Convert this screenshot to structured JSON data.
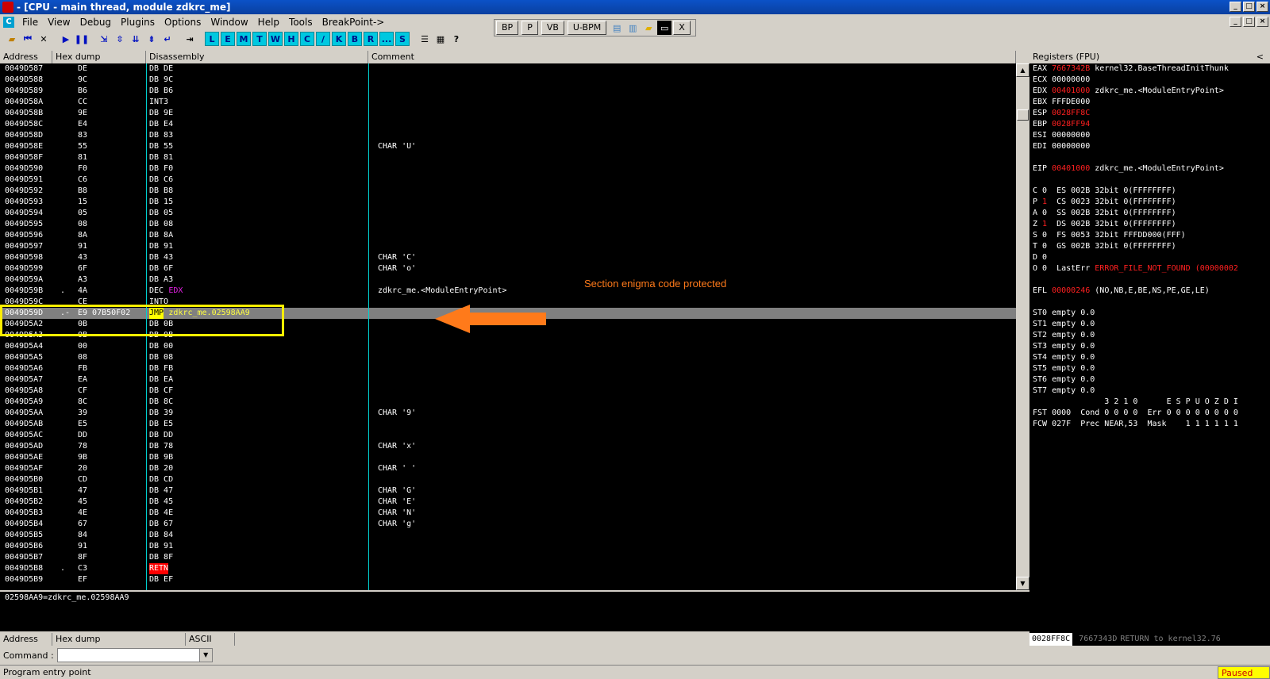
{
  "window": {
    "title": "- [CPU - main thread, module zdkrc_me]"
  },
  "menu": {
    "icon_letter": "C",
    "items": [
      "File",
      "View",
      "Debug",
      "Plugins",
      "Options",
      "Window",
      "Help",
      "Tools",
      "BreakPoint->"
    ]
  },
  "toolbar": {
    "letter_buttons": [
      "L",
      "E",
      "M",
      "T",
      "W",
      "H",
      "C",
      "/",
      "K",
      "B",
      "R",
      "...",
      "S"
    ],
    "help_label": "?"
  },
  "bp_toolbar": {
    "buttons": [
      "BP",
      "P",
      "VB",
      "U-BPM"
    ],
    "close_label": "X"
  },
  "cpu_headers": {
    "address": "Address",
    "hex": "Hex dump",
    "disasm": "Disassembly",
    "comment": "Comment"
  },
  "disasm_rows": [
    {
      "addr": "0049D587",
      "mk": "",
      "hex": "DE",
      "dis": "DB DE",
      "cmt": ""
    },
    {
      "addr": "0049D588",
      "mk": "",
      "hex": "9C",
      "dis": "DB 9C",
      "cmt": ""
    },
    {
      "addr": "0049D589",
      "mk": "",
      "hex": "B6",
      "dis": "DB B6",
      "cmt": ""
    },
    {
      "addr": "0049D58A",
      "mk": "",
      "hex": "CC",
      "dis": "INT3",
      "cmt": ""
    },
    {
      "addr": "0049D58B",
      "mk": "",
      "hex": "9E",
      "dis": "DB 9E",
      "cmt": ""
    },
    {
      "addr": "0049D58C",
      "mk": "",
      "hex": "E4",
      "dis": "DB E4",
      "cmt": ""
    },
    {
      "addr": "0049D58D",
      "mk": "",
      "hex": "83",
      "dis": "DB 83",
      "cmt": ""
    },
    {
      "addr": "0049D58E",
      "mk": "",
      "hex": "55",
      "dis": "DB 55",
      "cmt": "CHAR 'U'"
    },
    {
      "addr": "0049D58F",
      "mk": "",
      "hex": "81",
      "dis": "DB 81",
      "cmt": ""
    },
    {
      "addr": "0049D590",
      "mk": "",
      "hex": "F0",
      "dis": "DB F0",
      "cmt": ""
    },
    {
      "addr": "0049D591",
      "mk": "",
      "hex": "C6",
      "dis": "DB C6",
      "cmt": ""
    },
    {
      "addr": "0049D592",
      "mk": "",
      "hex": "B8",
      "dis": "DB B8",
      "cmt": ""
    },
    {
      "addr": "0049D593",
      "mk": "",
      "hex": "15",
      "dis": "DB 15",
      "cmt": ""
    },
    {
      "addr": "0049D594",
      "mk": "",
      "hex": "05",
      "dis": "DB 05",
      "cmt": ""
    },
    {
      "addr": "0049D595",
      "mk": "",
      "hex": "08",
      "dis": "DB 08",
      "cmt": ""
    },
    {
      "addr": "0049D596",
      "mk": "",
      "hex": "8A",
      "dis": "DB 8A",
      "cmt": ""
    },
    {
      "addr": "0049D597",
      "mk": "",
      "hex": "91",
      "dis": "DB 91",
      "cmt": ""
    },
    {
      "addr": "0049D598",
      "mk": "",
      "hex": "43",
      "dis": "DB 43",
      "cmt": "CHAR 'C'"
    },
    {
      "addr": "0049D599",
      "mk": "",
      "hex": "6F",
      "dis": "DB 6F",
      "cmt": "CHAR 'o'"
    },
    {
      "addr": "0049D59A",
      "mk": "",
      "hex": "A3",
      "dis": "DB A3",
      "cmt": ""
    },
    {
      "addr": "0049D59B",
      "mk": ".",
      "hex": "4A",
      "dis": "DEC",
      "dis2": "EDX",
      "cmt": "zdkrc_me.<ModuleEntryPoint>"
    },
    {
      "addr": "0049D59C",
      "mk": "",
      "hex": "CE",
      "dis": "INTO",
      "cmt": ""
    },
    {
      "addr": "0049D59D",
      "mk": ".-",
      "hex": "E9 07B50F02",
      "dis": "JMP",
      "dis2": "zdkrc_me.02598AA9",
      "cmt": "",
      "sel": true
    },
    {
      "addr": "0049D5A2",
      "mk": "",
      "hex": "0B",
      "dis": "DB 0B",
      "cmt": ""
    },
    {
      "addr": "0049D5A3",
      "mk": "",
      "hex": "0B",
      "dis": "DB 0B",
      "cmt": ""
    },
    {
      "addr": "0049D5A4",
      "mk": "",
      "hex": "00",
      "dis": "DB 00",
      "cmt": ""
    },
    {
      "addr": "0049D5A5",
      "mk": "",
      "hex": "08",
      "dis": "DB 08",
      "cmt": ""
    },
    {
      "addr": "0049D5A6",
      "mk": "",
      "hex": "FB",
      "dis": "DB FB",
      "cmt": ""
    },
    {
      "addr": "0049D5A7",
      "mk": "",
      "hex": "EA",
      "dis": "DB EA",
      "cmt": ""
    },
    {
      "addr": "0049D5A8",
      "mk": "",
      "hex": "CF",
      "dis": "DB CF",
      "cmt": ""
    },
    {
      "addr": "0049D5A9",
      "mk": "",
      "hex": "8C",
      "dis": "DB 8C",
      "cmt": ""
    },
    {
      "addr": "0049D5AA",
      "mk": "",
      "hex": "39",
      "dis": "DB 39",
      "cmt": "CHAR '9'"
    },
    {
      "addr": "0049D5AB",
      "mk": "",
      "hex": "E5",
      "dis": "DB E5",
      "cmt": ""
    },
    {
      "addr": "0049D5AC",
      "mk": "",
      "hex": "DD",
      "dis": "DB DD",
      "cmt": ""
    },
    {
      "addr": "0049D5AD",
      "mk": "",
      "hex": "78",
      "dis": "DB 78",
      "cmt": "CHAR 'x'"
    },
    {
      "addr": "0049D5AE",
      "mk": "",
      "hex": "9B",
      "dis": "DB 9B",
      "cmt": ""
    },
    {
      "addr": "0049D5AF",
      "mk": "",
      "hex": "20",
      "dis": "DB 20",
      "cmt": "CHAR ' '"
    },
    {
      "addr": "0049D5B0",
      "mk": "",
      "hex": "CD",
      "dis": "DB CD",
      "cmt": ""
    },
    {
      "addr": "0049D5B1",
      "mk": "",
      "hex": "47",
      "dis": "DB 47",
      "cmt": "CHAR 'G'"
    },
    {
      "addr": "0049D5B2",
      "mk": "",
      "hex": "45",
      "dis": "DB 45",
      "cmt": "CHAR 'E'"
    },
    {
      "addr": "0049D5B3",
      "mk": "",
      "hex": "4E",
      "dis": "DB 4E",
      "cmt": "CHAR 'N'"
    },
    {
      "addr": "0049D5B4",
      "mk": "",
      "hex": "67",
      "dis": "DB 67",
      "cmt": "CHAR 'g'"
    },
    {
      "addr": "0049D5B5",
      "mk": "",
      "hex": "84",
      "dis": "DB 84",
      "cmt": ""
    },
    {
      "addr": "0049D5B6",
      "mk": "",
      "hex": "91",
      "dis": "DB 91",
      "cmt": ""
    },
    {
      "addr": "0049D5B7",
      "mk": "",
      "hex": "8F",
      "dis": "DB 8F",
      "cmt": ""
    },
    {
      "addr": "0049D5B8",
      "mk": ".",
      "hex": "C3",
      "dis": "RETN",
      "cmt": ""
    },
    {
      "addr": "0049D5B9",
      "mk": "",
      "hex": "EF",
      "dis": "DB EF",
      "cmt": ""
    }
  ],
  "annotation": {
    "text": "Section enigma code protected",
    "color": "#ff7a1a",
    "highlight_color": "#ffee00"
  },
  "registers": {
    "header": "Registers (FPU)",
    "collapse": "<",
    "lines": [
      [
        "EAX ",
        "7667342B",
        " kernel32.BaseThreadInitThunk"
      ],
      [
        "ECX 00000000"
      ],
      [
        "EDX ",
        "00401000",
        " zdkrc_me.<ModuleEntryPoint>"
      ],
      [
        "EBX FFFDE000"
      ],
      [
        "ESP ",
        "0028FF8C",
        ""
      ],
      [
        "EBP ",
        "0028FF94",
        ""
      ],
      [
        "ESI 00000000"
      ],
      [
        "EDI 00000000"
      ],
      [
        ""
      ],
      [
        "EIP ",
        "00401000",
        " zdkrc_me.<ModuleEntryPoint>"
      ],
      [
        ""
      ],
      [
        "C 0  ES 002B 32bit 0(FFFFFFFF)"
      ],
      [
        "P ",
        "1",
        "  CS 0023 32bit 0(FFFFFFFF)"
      ],
      [
        "A 0  SS 002B 32bit 0(FFFFFFFF)"
      ],
      [
        "Z ",
        "1",
        "  DS 002B 32bit 0(FFFFFFFF)"
      ],
      [
        "S 0  FS 0053 32bit FFFDD000(FFF)"
      ],
      [
        "T 0  GS 002B 32bit 0(FFFFFFFF)"
      ],
      [
        "D 0"
      ],
      [
        "O 0  LastErr ",
        "ERROR_FILE_NOT_FOUND (00000002",
        ""
      ],
      [
        ""
      ],
      [
        "EFL ",
        "00000246",
        " (NO,NB,E,BE,NS,PE,GE,LE)"
      ],
      [
        ""
      ],
      [
        "ST0 empty 0.0"
      ],
      [
        "ST1 empty 0.0"
      ],
      [
        "ST2 empty 0.0"
      ],
      [
        "ST3 empty 0.0"
      ],
      [
        "ST4 empty 0.0"
      ],
      [
        "ST5 empty 0.0"
      ],
      [
        "ST6 empty 0.0"
      ],
      [
        "ST7 empty 0.0"
      ],
      [
        "               3 2 1 0      E S P U O Z D I"
      ],
      [
        "FST 0000  Cond 0 0 0 0  Err 0 0 0 0 0 0 0 0"
      ],
      [
        "FCW 027F  Prec NEAR,53  Mask    1 1 1 1 1 1"
      ]
    ]
  },
  "info_line": "02598AA9=zdkrc_me.02598AA9",
  "dump_headers": {
    "address": "Address",
    "hex": "Hex dump",
    "ascii": "ASCII"
  },
  "stack": {
    "addr": "0028FF8C",
    "val": "7667343D",
    "cmt": "RETURN to kernel32.76"
  },
  "command": {
    "label": "Command :",
    "value": ""
  },
  "status": {
    "left": "Program entry point",
    "right": "Paused"
  }
}
